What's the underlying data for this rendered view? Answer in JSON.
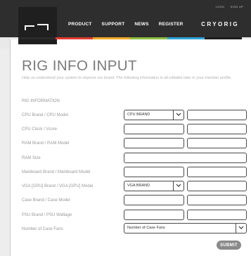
{
  "header": {
    "top_links": [
      "LOGO",
      "SIGN UP"
    ],
    "nav": [
      "PRODUCT",
      "SUPPORT",
      "NEWS",
      "REGISTER"
    ],
    "brand": "CRYORIG",
    "colorbar": [
      "#2b2b2b",
      "#e23a2e",
      "#f2a922",
      "#8cbd3f",
      "#2fa4d8",
      "#1d1d1d"
    ]
  },
  "form": {
    "title": "RIG INFO INPUT",
    "subtitle": "Help us understand your system to improve our brand.  The following information is all editable later in your member profile.",
    "section": "RIG INFORMATION",
    "rows": [
      {
        "label": "CPU Brand / CPU Model",
        "select_value": "CPU BRAND"
      },
      {
        "label": "CPU Clock / Vcore"
      },
      {
        "label": "RAM Brand / RAM Model"
      },
      {
        "label": "RAM Size"
      },
      {
        "label": "Mainboard Brand / Mainboard Model"
      },
      {
        "label": "VGA [GPU] Brand / VGA [GPU] Model",
        "select_value": "VGA BRAND"
      },
      {
        "label": "Case Brand / Case Model"
      },
      {
        "label": "PSU Brand / PSU Wattage"
      },
      {
        "label": "Number of Case Fans",
        "select_value": "Number of Case Fans"
      }
    ],
    "submit": "SUBMIT"
  }
}
